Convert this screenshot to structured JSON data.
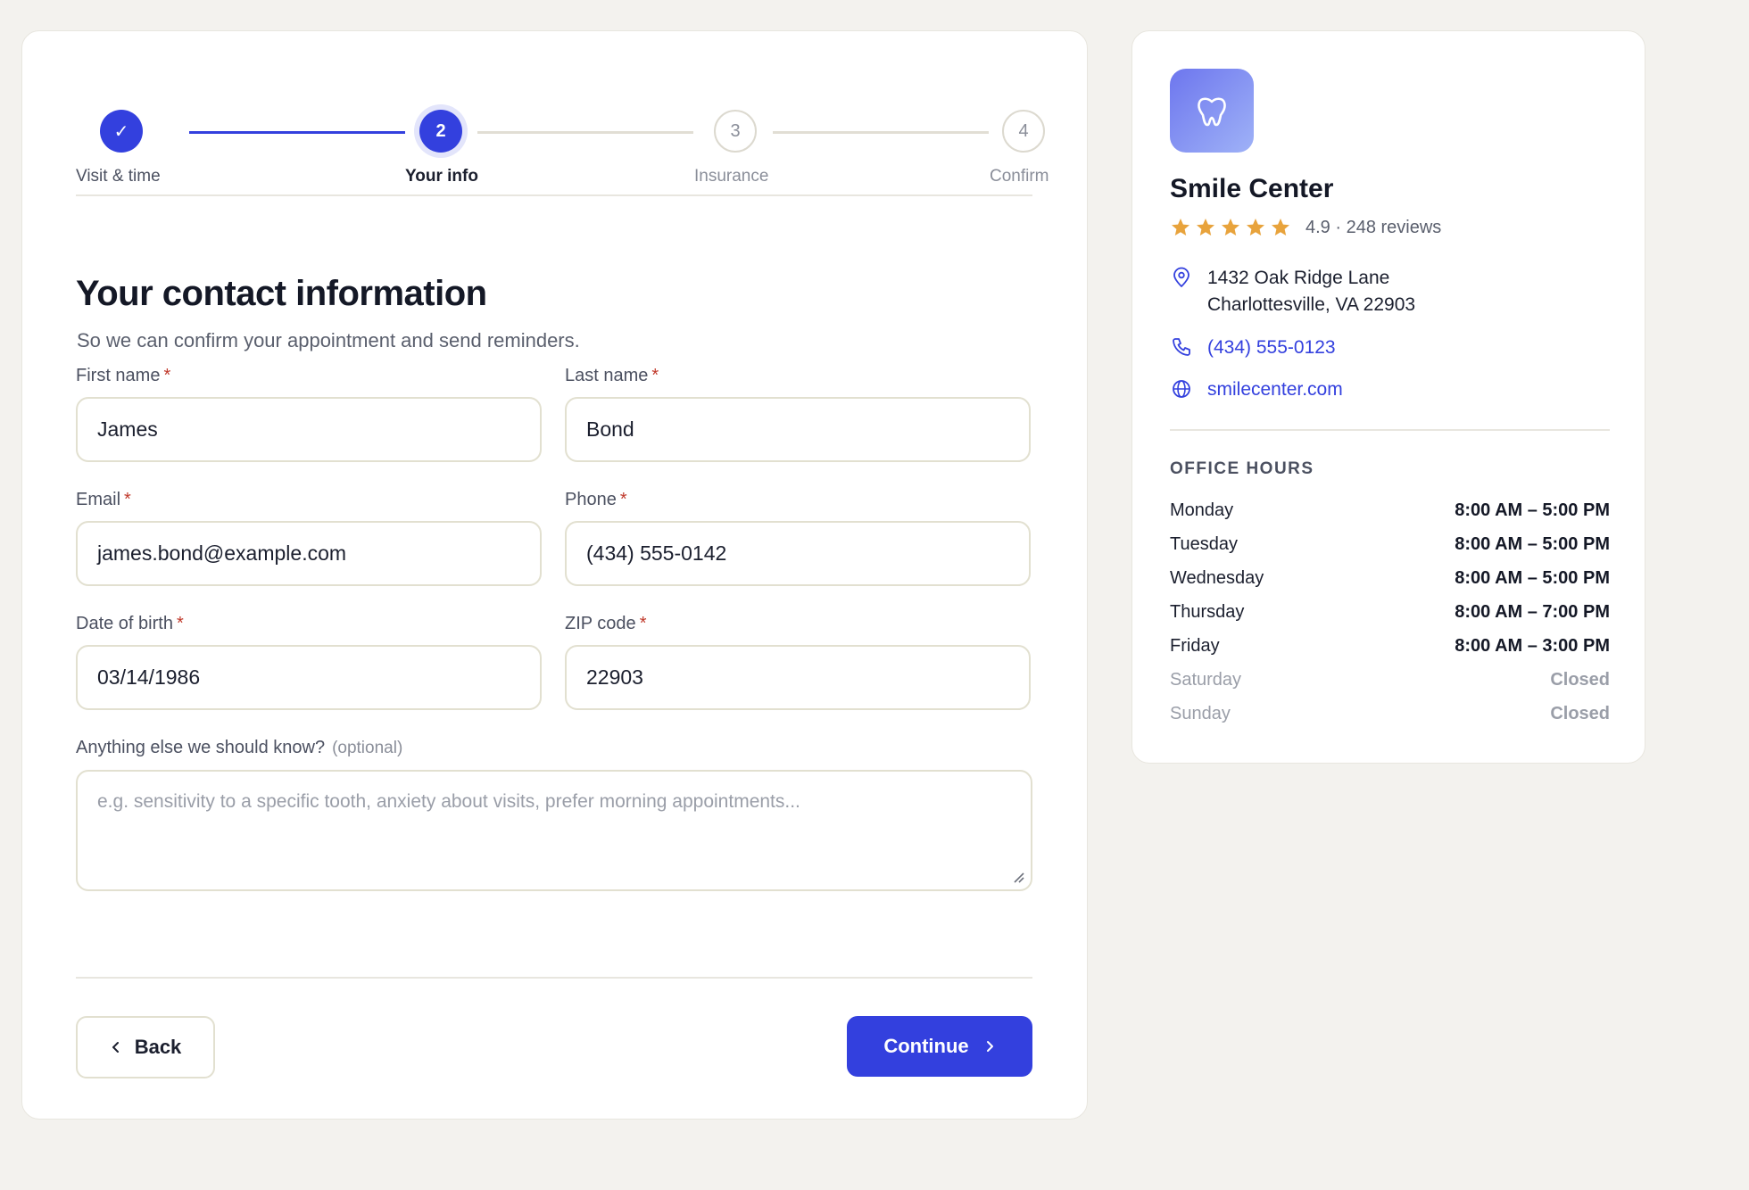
{
  "stepper": {
    "steps": [
      {
        "number": "✓",
        "label": "Visit & time",
        "state": "done"
      },
      {
        "number": "2",
        "label": "Your info",
        "state": "current"
      },
      {
        "number": "3",
        "label": "Insurance",
        "state": "todo"
      },
      {
        "number": "4",
        "label": "Confirm",
        "state": "todo"
      }
    ]
  },
  "form": {
    "title": "Your contact information",
    "subtitle": "So we can confirm your appointment and send reminders.",
    "required_marker": "*",
    "first_name": {
      "label": "First name",
      "value": "James"
    },
    "last_name": {
      "label": "Last name",
      "value": "Bond"
    },
    "email": {
      "label": "Email",
      "value": "james.bond@example.com"
    },
    "phone": {
      "label": "Phone",
      "value": "(434) 555-0142"
    },
    "dob": {
      "label": "Date of birth",
      "value": "03/14/1986"
    },
    "zip": {
      "label": "ZIP code",
      "value": "22903"
    },
    "notes": {
      "label": "Anything else we should know?",
      "optional": "(optional)",
      "placeholder": "e.g. sensitivity to a specific tooth, anxiety about visits, prefer morning appointments..."
    }
  },
  "actions": {
    "back_label": "Back",
    "continue_label": "Continue"
  },
  "clinic": {
    "name": "Smile Center",
    "rating": 4.9,
    "rating_text": "4.9 · 248 reviews",
    "address_line1": "1432 Oak Ridge Lane",
    "address_line2": "Charlottesville, VA 22903",
    "phone": "(434) 555-0123",
    "website": "smilecenter.com",
    "hours_title": "OFFICE HOURS",
    "hours": [
      {
        "day": "Monday",
        "time": "8:00 AM – 5:00 PM"
      },
      {
        "day": "Tuesday",
        "time": "8:00 AM – 5:00 PM"
      },
      {
        "day": "Wednesday",
        "time": "8:00 AM – 5:00 PM"
      },
      {
        "day": "Thursday",
        "time": "8:00 AM – 7:00 PM"
      },
      {
        "day": "Friday",
        "time": "8:00 AM – 3:00 PM"
      },
      {
        "day": "Saturday",
        "time": "Closed"
      },
      {
        "day": "Sunday",
        "time": "Closed"
      }
    ]
  },
  "colors": {
    "accent": "#3340de",
    "star": "#e8a33c",
    "background": "#f3f2ee",
    "required": "#c0392b"
  }
}
